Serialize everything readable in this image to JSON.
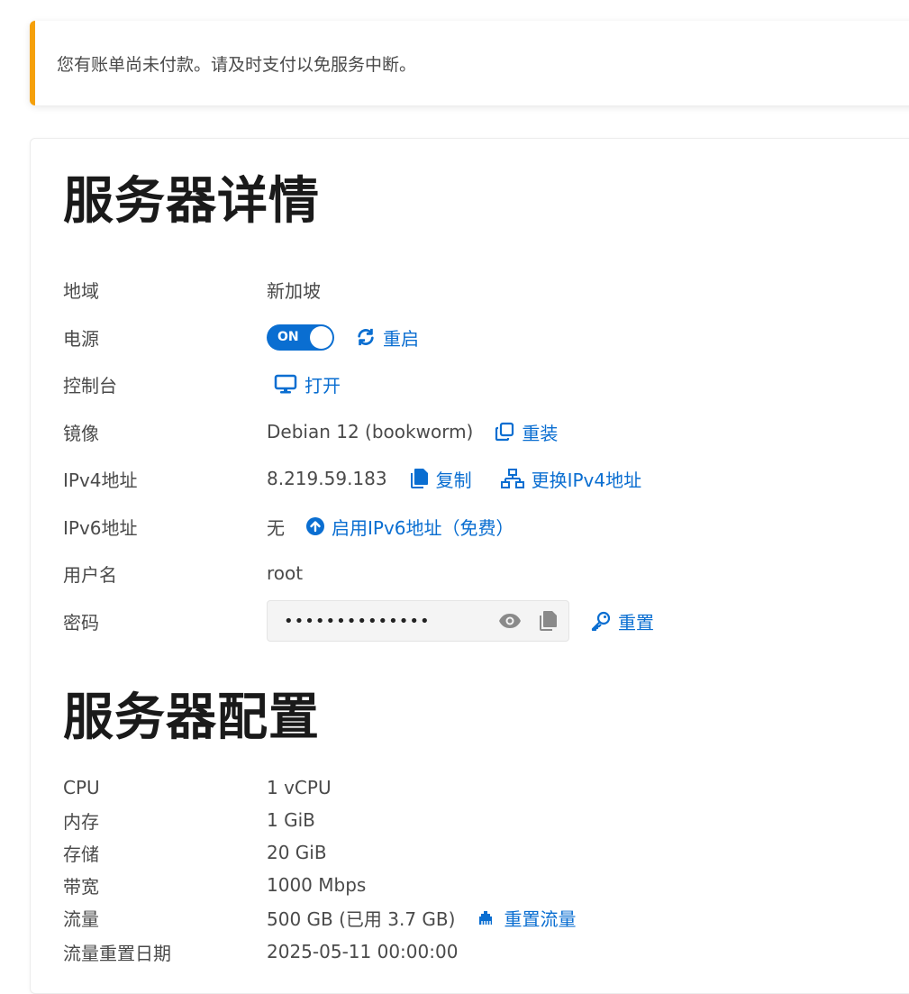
{
  "alert": {
    "text": "您有账单尚未付款。请及时支付以免服务中断。"
  },
  "details": {
    "title": "服务器详情",
    "region": {
      "label": "地域",
      "value": "新加坡"
    },
    "power": {
      "label": "电源",
      "toggle": "ON",
      "restart": "重启"
    },
    "console": {
      "label": "控制台",
      "open": "打开"
    },
    "image": {
      "label": "镜像",
      "value": "Debian 12 (bookworm)",
      "reinstall": "重装"
    },
    "ipv4": {
      "label": "IPv4地址",
      "value": "8.219.59.183",
      "copy": "复制",
      "change": "更换IPv4地址"
    },
    "ipv6": {
      "label": "IPv6地址",
      "value": "无",
      "enable": "启用IPv6地址（免费）"
    },
    "username": {
      "label": "用户名",
      "value": "root"
    },
    "password": {
      "label": "密码",
      "masked": "••••••••••••••",
      "reset": "重置"
    }
  },
  "config": {
    "title": "服务器配置",
    "cpu": {
      "label": "CPU",
      "value": "1 vCPU"
    },
    "memory": {
      "label": "内存",
      "value": "1 GiB"
    },
    "storage": {
      "label": "存储",
      "value": "20 GiB"
    },
    "bandwidth": {
      "label": "带宽",
      "value": "1000 Mbps"
    },
    "traffic": {
      "label": "流量",
      "value": "500 GB (已用 3.7 GB)",
      "reset": "重置流量"
    },
    "reset_date": {
      "label": "流量重置日期",
      "value": "2025-05-11 00:00:00"
    }
  },
  "colors": {
    "accent": "#0a6ed1",
    "warning": "#f5a00a"
  }
}
